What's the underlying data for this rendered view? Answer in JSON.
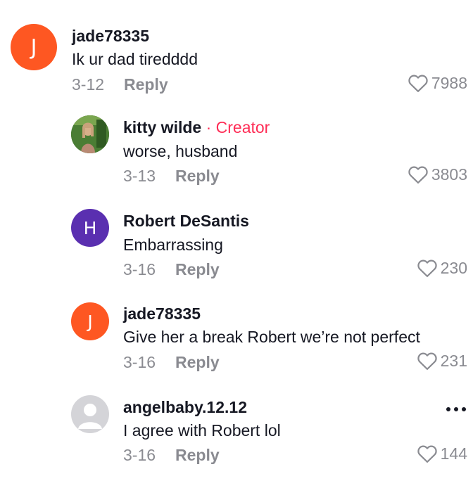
{
  "comments": [
    {
      "avatar_letter": "J",
      "avatar_color": "#fe5722",
      "username": "jade78335",
      "text": "Ik ur dad tiredddd",
      "date": "3-12",
      "reply_label": "Reply",
      "likes": "7988"
    },
    {
      "username": "kitty wilde",
      "badge": "· Creator",
      "text": "worse, husband",
      "date": "3-13",
      "reply_label": "Reply",
      "likes": "3803"
    },
    {
      "avatar_letter": "H",
      "avatar_color": "#5a2fb0",
      "username": "Robert DeSantis",
      "text": "Embarrassing",
      "date": "3-16",
      "reply_label": "Reply",
      "likes": "230"
    },
    {
      "avatar_letter": "J",
      "avatar_color": "#fe5722",
      "username": "jade78335",
      "text": "Give her a break Robert we’re not perfect",
      "date": "3-16",
      "reply_label": "Reply",
      "likes": "231"
    },
    {
      "username": "angelbaby.12.12",
      "text": "I agree with Robert lol",
      "date": "3-16",
      "reply_label": "Reply",
      "likes": "144"
    }
  ],
  "icons": {
    "like": "heart-outline-icon",
    "more": "more-dots-icon"
  }
}
